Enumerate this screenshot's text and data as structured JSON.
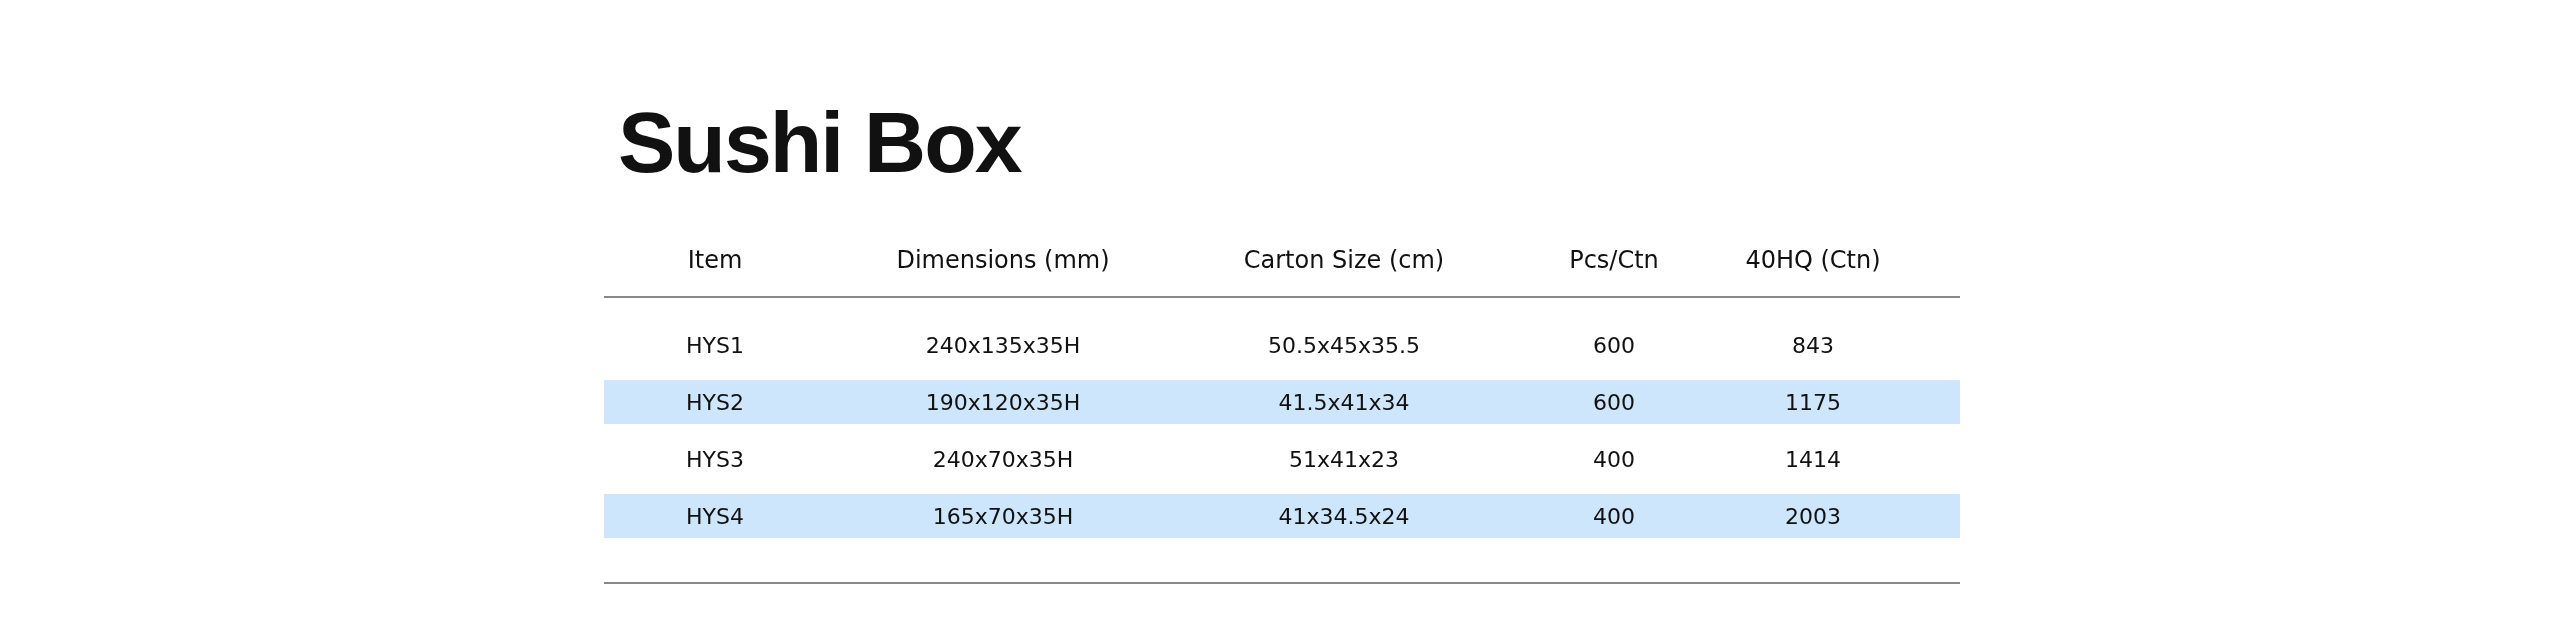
{
  "title": "Sushi Box",
  "table": {
    "columns": [
      "Item",
      "Dimensions (mm)",
      "Carton Size (cm)",
      "Pcs/Ctn",
      "40HQ (Ctn)"
    ],
    "rows": [
      [
        "HYS1",
        "240x135x35H",
        "50.5x45x35.5",
        "600",
        "843"
      ],
      [
        "HYS2",
        "190x120x35H",
        "41.5x41x34",
        "600",
        "1175"
      ],
      [
        "HYS3",
        "240x70x35H",
        "51x41x23",
        "400",
        "1414"
      ],
      [
        "HYS4",
        "165x70x35H",
        "41x34.5x24",
        "400",
        "2003"
      ]
    ]
  }
}
